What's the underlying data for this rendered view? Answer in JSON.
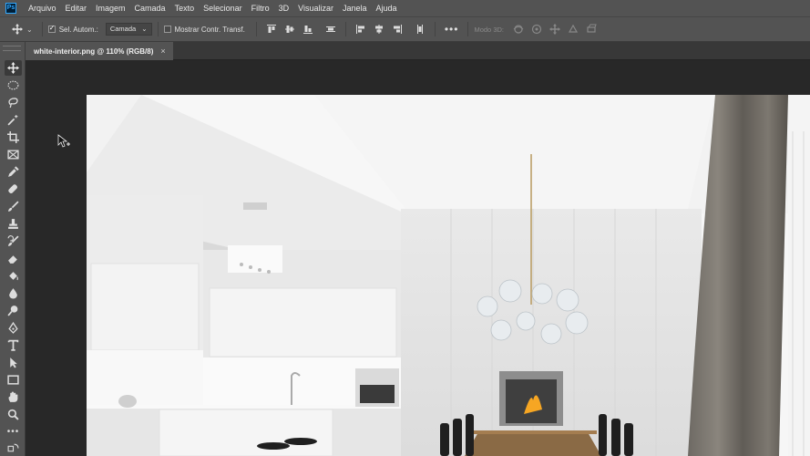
{
  "app": {
    "logo": "Ps"
  },
  "menu": [
    "Arquivo",
    "Editar",
    "Imagem",
    "Camada",
    "Texto",
    "Selecionar",
    "Filtro",
    "3D",
    "Visualizar",
    "Janela",
    "Ajuda"
  ],
  "options": {
    "auto_select_label": "Sel. Autom.:",
    "auto_select_checked": true,
    "auto_select_target": "Camada",
    "transform_label": "Mostrar Contr. Transf.",
    "transform_checked": false,
    "mode_3d_label": "Modo 3D:"
  },
  "document": {
    "tab_title": "white-interior.png @ 110% (RGB/8)",
    "close_symbol": "×"
  },
  "tools": [
    "move-tool",
    "marquee-tool",
    "lasso-tool",
    "quick-selection-tool",
    "crop-tool",
    "frame-tool",
    "eyedropper-tool",
    "healing-brush-tool",
    "brush-tool",
    "clone-stamp-tool",
    "history-brush-tool",
    "eraser-tool",
    "paint-bucket-tool",
    "blur-tool",
    "dodge-tool",
    "pen-tool",
    "type-tool",
    "path-selection-tool",
    "rectangle-tool",
    "hand-tool",
    "zoom-tool",
    "more-tools"
  ],
  "colors": {
    "chrome": "#535353",
    "workspace": "#282828",
    "accent": "#31a8ff"
  }
}
